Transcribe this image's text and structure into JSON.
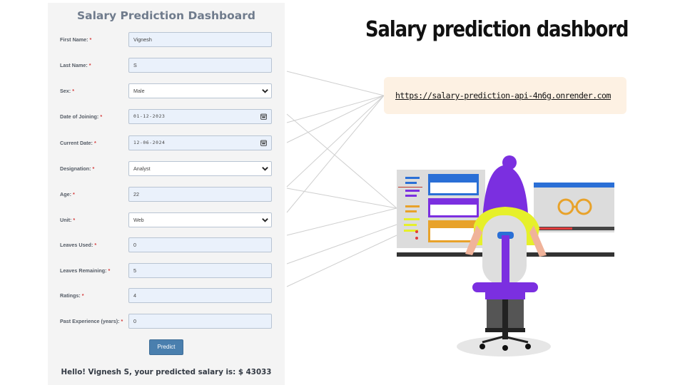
{
  "form": {
    "title": "Salary Prediction Dashboard",
    "required_marker": "*",
    "fields": [
      {
        "label": "First Name:",
        "value": "Vignesh",
        "type": "text"
      },
      {
        "label": "Last Name:",
        "value": "S",
        "type": "text"
      },
      {
        "label": "Sex:",
        "value": "Male",
        "type": "select"
      },
      {
        "label": "Date of Joining:",
        "value": "01-12-2023",
        "type": "date"
      },
      {
        "label": "Current Date:",
        "value": "12-06-2024",
        "type": "date"
      },
      {
        "label": "Designation:",
        "value": "Analyst",
        "type": "select"
      },
      {
        "label": "Age:",
        "value": "22",
        "type": "number"
      },
      {
        "label": "Unit:",
        "value": "Web",
        "type": "select"
      },
      {
        "label": "Leaves Used:",
        "value": "0",
        "type": "number"
      },
      {
        "label": "Leaves Remaining:",
        "value": "5",
        "type": "number"
      },
      {
        "label": "Ratings:",
        "value": "4",
        "type": "number"
      },
      {
        "label": "Past Experience (years):",
        "value": "0",
        "type": "number"
      }
    ],
    "predict_label": "Predict",
    "result_text": "Hello! Vignesh S, your predicted salary is: $ 43033"
  },
  "slide": {
    "heading": "Salary prediction dashbord",
    "url": "https://salary-prediction-api-4n6g.onrender.com"
  },
  "colors": {
    "panel_bg": "#f4f4f4",
    "button": "#4a7fae",
    "url_box": "#fdf1e3",
    "hair": "#7b2fe0",
    "shirt": "#e6f02a"
  },
  "icons": [
    "chevron-down-icon",
    "calendar-icon"
  ]
}
